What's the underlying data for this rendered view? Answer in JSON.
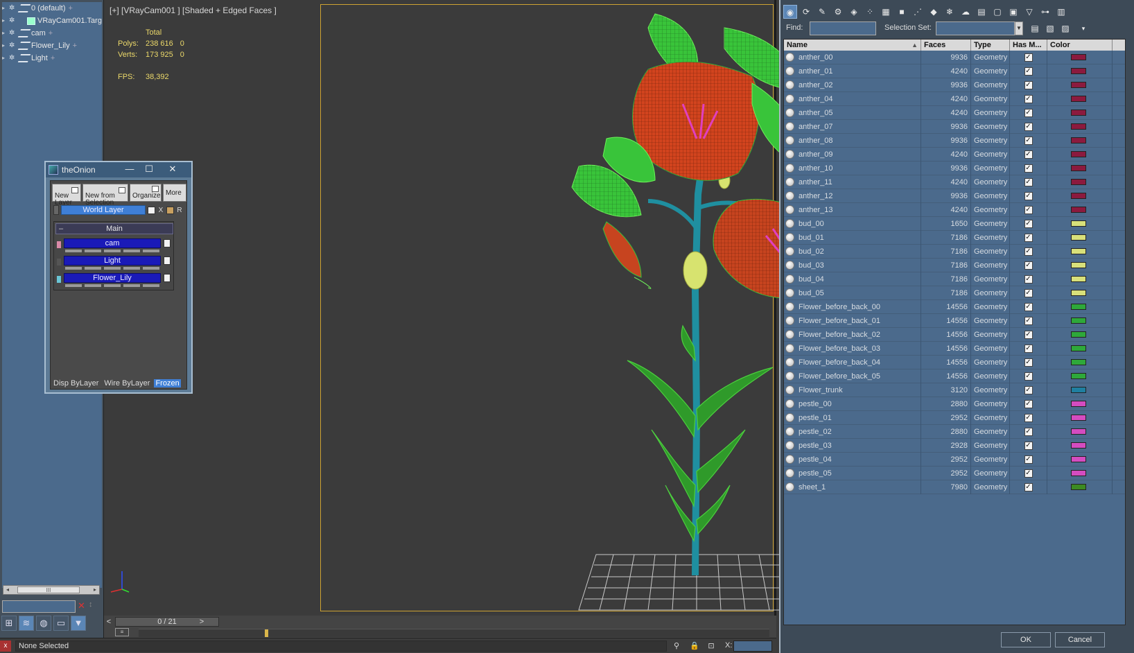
{
  "left_tree": {
    "items": [
      {
        "label": "0 (default)",
        "type": "layer"
      },
      {
        "label": "VRayCam001.Targ",
        "type": "object"
      },
      {
        "label": "cam",
        "type": "layer"
      },
      {
        "label": "Flower_Lily",
        "type": "layer"
      },
      {
        "label": "Light",
        "type": "layer"
      }
    ]
  },
  "viewport": {
    "label": "[+] [VRayCam001 ] [Shaded + Edged Faces ]",
    "stats": {
      "total_label": "Total",
      "polys_label": "Polys:",
      "polys_total": "238 616",
      "polys_sel": "0",
      "verts_label": "Verts:",
      "verts_total": "173 925",
      "verts_sel": "0",
      "fps_label": "FPS:",
      "fps_value": "38,392"
    }
  },
  "timeline": {
    "frame": "0 / 21",
    "prev": "<",
    "next": ">"
  },
  "status": {
    "text": "None Selected",
    "x_label": "X:"
  },
  "onion": {
    "title": "theOnion",
    "buttons": {
      "new_layer": "New\nLayer",
      "new_from_selection": "New from\nSelection",
      "organize": "Organize",
      "more": "More"
    },
    "world_layer": "World Layer",
    "x_letter": "X",
    "r_letter": "R",
    "group": "Main",
    "layers": [
      "cam",
      "Light",
      "Flower_Lily"
    ],
    "footer": {
      "disp": "Disp ByLayer",
      "wire": "Wire ByLayer",
      "frozen": "Frozen"
    }
  },
  "dialog": {
    "find_label": "Find:",
    "find_value": "",
    "selset_label": "Selection Set:",
    "columns": {
      "name": "Name",
      "faces": "Faces",
      "type": "Type",
      "has": "Has M...",
      "color": "Color"
    },
    "ok": "OK",
    "cancel": "Cancel",
    "rows": [
      {
        "name": "anther_00",
        "faces": "9936",
        "type": "Geometry",
        "color": "#8b1a3e"
      },
      {
        "name": "anther_01",
        "faces": "4240",
        "type": "Geometry",
        "color": "#8b1a3e"
      },
      {
        "name": "anther_02",
        "faces": "9936",
        "type": "Geometry",
        "color": "#8b1a3e"
      },
      {
        "name": "anther_04",
        "faces": "4240",
        "type": "Geometry",
        "color": "#8b1a3e"
      },
      {
        "name": "anther_05",
        "faces": "4240",
        "type": "Geometry",
        "color": "#8b1a3e"
      },
      {
        "name": "anther_07",
        "faces": "9936",
        "type": "Geometry",
        "color": "#8b1a3e"
      },
      {
        "name": "anther_08",
        "faces": "9936",
        "type": "Geometry",
        "color": "#8b1a3e"
      },
      {
        "name": "anther_09",
        "faces": "4240",
        "type": "Geometry",
        "color": "#8b1a3e"
      },
      {
        "name": "anther_10",
        "faces": "9936",
        "type": "Geometry",
        "color": "#8b1a3e"
      },
      {
        "name": "anther_11",
        "faces": "4240",
        "type": "Geometry",
        "color": "#8b1a3e"
      },
      {
        "name": "anther_12",
        "faces": "9936",
        "type": "Geometry",
        "color": "#8b1a3e"
      },
      {
        "name": "anther_13",
        "faces": "4240",
        "type": "Geometry",
        "color": "#8b1a3e"
      },
      {
        "name": "bud_00",
        "faces": "1650",
        "type": "Geometry",
        "color": "#d8e07a"
      },
      {
        "name": "bud_01",
        "faces": "7186",
        "type": "Geometry",
        "color": "#d8e07a"
      },
      {
        "name": "bud_02",
        "faces": "7186",
        "type": "Geometry",
        "color": "#d8e07a"
      },
      {
        "name": "bud_03",
        "faces": "7186",
        "type": "Geometry",
        "color": "#d8e07a"
      },
      {
        "name": "bud_04",
        "faces": "7186",
        "type": "Geometry",
        "color": "#d8e07a"
      },
      {
        "name": "bud_05",
        "faces": "7186",
        "type": "Geometry",
        "color": "#d8e07a"
      },
      {
        "name": "Flower_before_back_00",
        "faces": "14556",
        "type": "Geometry",
        "color": "#2ea83a"
      },
      {
        "name": "Flower_before_back_01",
        "faces": "14556",
        "type": "Geometry",
        "color": "#2ea83a"
      },
      {
        "name": "Flower_before_back_02",
        "faces": "14556",
        "type": "Geometry",
        "color": "#2ea83a"
      },
      {
        "name": "Flower_before_back_03",
        "faces": "14556",
        "type": "Geometry",
        "color": "#2ea83a"
      },
      {
        "name": "Flower_before_back_04",
        "faces": "14556",
        "type": "Geometry",
        "color": "#2ea83a"
      },
      {
        "name": "Flower_before_back_05",
        "faces": "14556",
        "type": "Geometry",
        "color": "#2ea83a"
      },
      {
        "name": "Flower_trunk",
        "faces": "3120",
        "type": "Geometry",
        "color": "#1f7fa0"
      },
      {
        "name": "pestle_00",
        "faces": "2880",
        "type": "Geometry",
        "color": "#d44cc0"
      },
      {
        "name": "pestle_01",
        "faces": "2952",
        "type": "Geometry",
        "color": "#d44cc0"
      },
      {
        "name": "pestle_02",
        "faces": "2880",
        "type": "Geometry",
        "color": "#d44cc0"
      },
      {
        "name": "pestle_03",
        "faces": "2928",
        "type": "Geometry",
        "color": "#d44cc0"
      },
      {
        "name": "pestle_04",
        "faces": "2952",
        "type": "Geometry",
        "color": "#d44cc0"
      },
      {
        "name": "pestle_05",
        "faces": "2952",
        "type": "Geometry",
        "color": "#d44cc0"
      },
      {
        "name": "sheet_1",
        "faces": "7980",
        "type": "Geometry",
        "color": "#3c8a22"
      }
    ]
  },
  "colors": {
    "viewport_bg": "#3b3b3b",
    "panel_blue": "#4b6a8c",
    "safe_frame": "#cfa332",
    "stats_yellow": "#ecd96a",
    "petal": "#d2441e",
    "leaf": "#39c43a",
    "stem": "#1f8fa0"
  }
}
